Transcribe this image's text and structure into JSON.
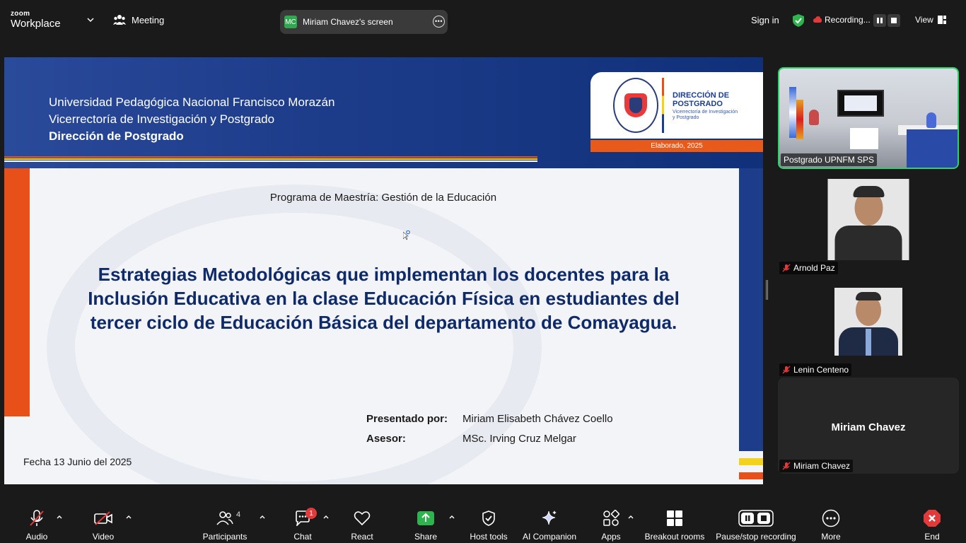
{
  "app": {
    "brand_top": "zoom",
    "brand_bottom": "Workplace",
    "meeting_label": "Meeting",
    "share_initials": "MC",
    "share_label": "Miriam Chavez's screen",
    "signin_label": "Sign in",
    "recording_label": "Recording...",
    "view_label": "View"
  },
  "slide": {
    "header_lines": [
      "Universidad Pedagógica Nacional Francisco Morazán",
      "Vicerrectoría de Investigación y Postgrado",
      "Dirección de Postgrado"
    ],
    "card_title_1": "DIRECCIÓN DE",
    "card_title_2": "POSTGRADO",
    "card_sub_1": "Vicerrectoría de Investigación",
    "card_sub_2": "y Postgrado",
    "elaborado": "Elaborado, 2025",
    "program": "Programa de Maestría: Gestión de la Educación",
    "title": "Estrategias Metodológicas que implementan los docentes para la Inclusión Educativa en la clase Educación Física en estudiantes del tercer ciclo de Educación Básica del departamento de Comayagua.",
    "presented_label": "Presentado por:",
    "presented_value": "Miriam Elisabeth Chávez Coello",
    "advisor_label": "Asesor:",
    "advisor_value": "MSc. Irving Cruz Melgar",
    "date": "Fecha 13 Junio del 2025",
    "colors": {
      "orange": "#e8501a",
      "navy": "#1d3c8a",
      "yellow": "#f2d21a"
    }
  },
  "participants": [
    {
      "name": "Postgrado UPNFM SPS",
      "muted": false,
      "active_speaker": true
    },
    {
      "name": "Arnold Paz",
      "muted": true
    },
    {
      "name": "Lenin Centeno",
      "muted": true
    },
    {
      "name": "Miriam Chavez",
      "muted": true,
      "display_name": "Miriam Chavez"
    }
  ],
  "toolbar": {
    "audio": "Audio",
    "video": "Video",
    "participants": "Participants",
    "participants_count": "4",
    "chat": "Chat",
    "chat_badge": "1",
    "react": "React",
    "share": "Share",
    "host_tools": "Host tools",
    "ai_companion": "AI Companion",
    "apps": "Apps",
    "breakout": "Breakout rooms",
    "pause_recording": "Pause/stop recording",
    "more": "More",
    "end": "End"
  }
}
